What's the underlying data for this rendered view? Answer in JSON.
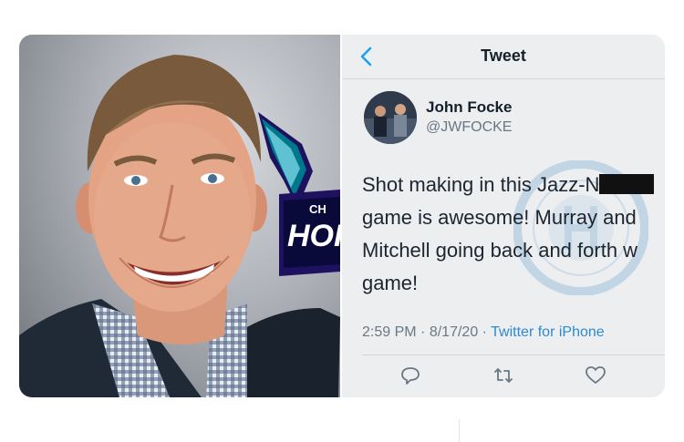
{
  "photo": {
    "logo_text_small": "CH",
    "logo_text_large": "HOR"
  },
  "tweet": {
    "header_title": "Tweet",
    "author_name": "John Focke",
    "author_handle": "@JWFOCKE",
    "text_lines": [
      "Shot making in this Jazz-N",
      "game is awesome! Murray and",
      "Mitchell going back and forth w",
      "game!"
    ],
    "time": "2:59 PM",
    "date": "8/17/20",
    "separator": "·",
    "source": "Twitter for iPhone"
  },
  "colors": {
    "accent": "#1da1f2",
    "panel_bg": "#eceef0"
  }
}
